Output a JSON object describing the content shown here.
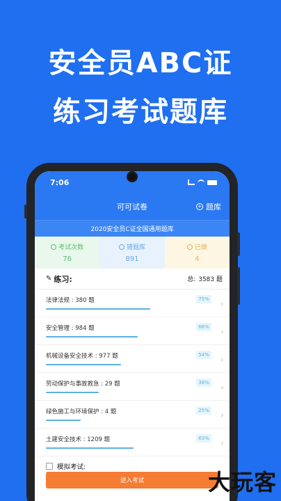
{
  "promo": {
    "line1": "安全员ABC证",
    "line2": "练习考试题库"
  },
  "status_bar": {
    "time": "7:06"
  },
  "nav": {
    "title": "可可试卷",
    "right_label": "题库"
  },
  "subtitle": "2020安全员C证全国通用题库",
  "stats": [
    {
      "label": "考试次数",
      "value": "76"
    },
    {
      "label": "错题库",
      "value": "891"
    },
    {
      "label": "已做",
      "value": "4"
    }
  ],
  "practice": {
    "title": "练习:",
    "total_label": "总:",
    "total_value": "3583 题"
  },
  "items": [
    {
      "label": "法律法规 : 380 题",
      "percent": "75%",
      "progress": 0.75
    },
    {
      "label": "安全管理 : 984 题",
      "percent": "66%",
      "progress": 0.66
    },
    {
      "label": "机械设备安全技术 : 977 题",
      "percent": "54%",
      "progress": 0.54
    },
    {
      "label": "劳动保护与事故救急 : 29 题",
      "percent": "38%",
      "progress": 0.38
    },
    {
      "label": "绿色施工与环境保护 : 4 题",
      "percent": "25%",
      "progress": 0.25
    },
    {
      "label": "土建安全技术 : 1209 题",
      "percent": "63%",
      "progress": 0.63
    }
  ],
  "mock_exam": {
    "label": "模拟考试:"
  },
  "start_button": "进入考试",
  "watermark": "大玩客",
  "colors": {
    "background": "#1f6ff0",
    "header": "#2a78f2",
    "button": "#f57c33",
    "progress": "#5ab0e0"
  }
}
